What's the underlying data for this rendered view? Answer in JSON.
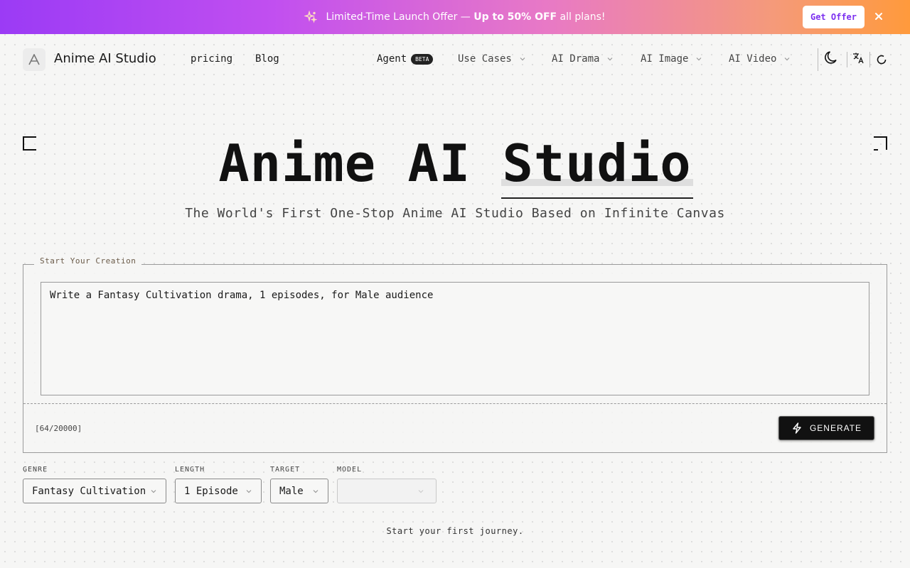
{
  "promo": {
    "prefix": "Limited-Time Launch Offer — ",
    "highlight": "Up to 50% OFF",
    "suffix": " all plans!",
    "button_label": "Get Offer",
    "gradient": [
      "#9b3bf5",
      "#ff9a3c"
    ]
  },
  "header": {
    "brand": "Anime AI Studio",
    "links": [
      "pricing",
      "Blog"
    ],
    "agent_label": "Agent",
    "agent_badge": "BETA",
    "dropdowns": [
      "Use Cases",
      "AI Drama",
      "AI Image",
      "AI Video"
    ],
    "icons": [
      "theme-moon-icon",
      "translate-icon",
      "refresh-icon"
    ]
  },
  "hero": {
    "title_plain": "Anime AI ",
    "title_highlight": "Studio",
    "subtitle": "The World's First One-Stop Anime AI Studio Based on Infinite Canvas"
  },
  "creation": {
    "legend": "Start Your Creation",
    "prompt": "Write a Fantasy Cultivation drama, 1 episodes, for Male audience",
    "counter": "[64/20000]",
    "generate_label": "GENERATE"
  },
  "options": {
    "genre": {
      "label": "GENRE",
      "value": "Fantasy Cultivation"
    },
    "length": {
      "label": "LENGTH",
      "value": "1 Episode"
    },
    "target": {
      "label": "TARGET",
      "value": "Male"
    },
    "model": {
      "label": "MODEL",
      "value": ""
    }
  },
  "footer_note": "Start your first journey."
}
